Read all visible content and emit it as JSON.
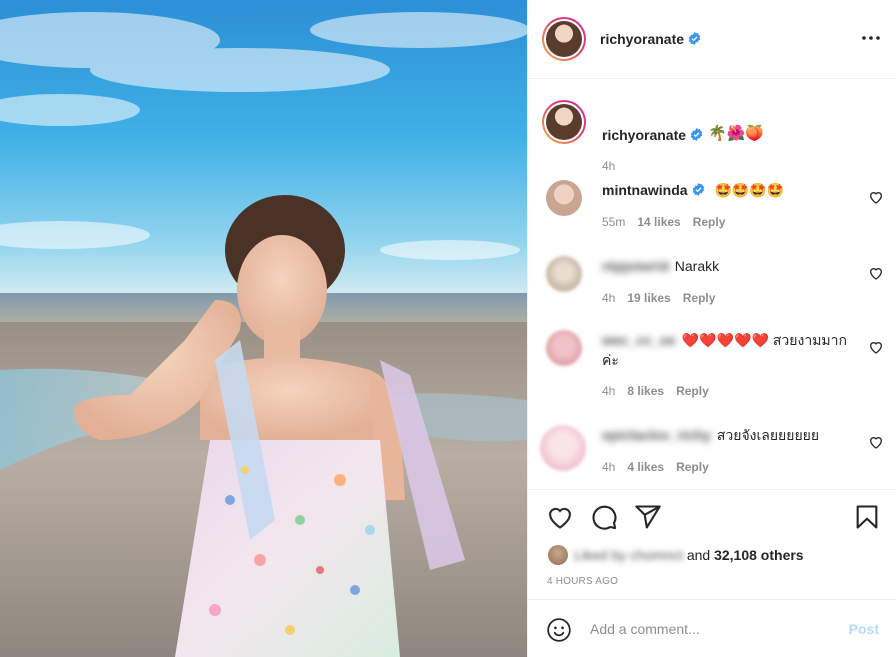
{
  "post": {
    "username": "richyoranate",
    "verified": true,
    "more_icon": "more-options-icon"
  },
  "caption": {
    "username": "richyoranate",
    "text": "🌴🌺🍑",
    "time": "4h"
  },
  "comments": [
    {
      "username": "mintnawinda",
      "verified": true,
      "text": "🤩🤩🤩🤩",
      "time": "55m",
      "likes": "14 likes",
      "reply": "Reply",
      "blurred": false
    },
    {
      "username": "ntpjstwrid",
      "verified": false,
      "text": "Narakk",
      "time": "4h",
      "likes": "19 likes",
      "reply": "Reply",
      "blurred": true
    },
    {
      "username": "wec_cc_oe",
      "verified": false,
      "text": "❤️❤️❤️❤️❤️ สวยงามมากค่ะ",
      "time": "4h",
      "likes": "8 likes",
      "reply": "Reply",
      "blurred": true
    },
    {
      "username": "epiclaclov_richy",
      "verified": false,
      "text": "สวยจังเลยยยยยย",
      "time": "4h",
      "likes": "4 likes",
      "reply": "Reply",
      "blurred": true
    }
  ],
  "actions": {
    "like_icon": "heart-icon",
    "comment_icon": "comment-icon",
    "share_icon": "share-icon",
    "save_icon": "bookmark-icon"
  },
  "likes_line": {
    "blurred_text": "Liked by chomnct",
    "suffix": " and ",
    "others": "32,108 others"
  },
  "post_time": "4 HOURS AGO",
  "comment_box": {
    "placeholder": "Add a comment...",
    "post_label": "Post"
  },
  "colors": {
    "accent": "#0095f6",
    "post_disabled": "#b3dbff",
    "border": "#efefef",
    "secondary_text": "#8e8e8e"
  }
}
